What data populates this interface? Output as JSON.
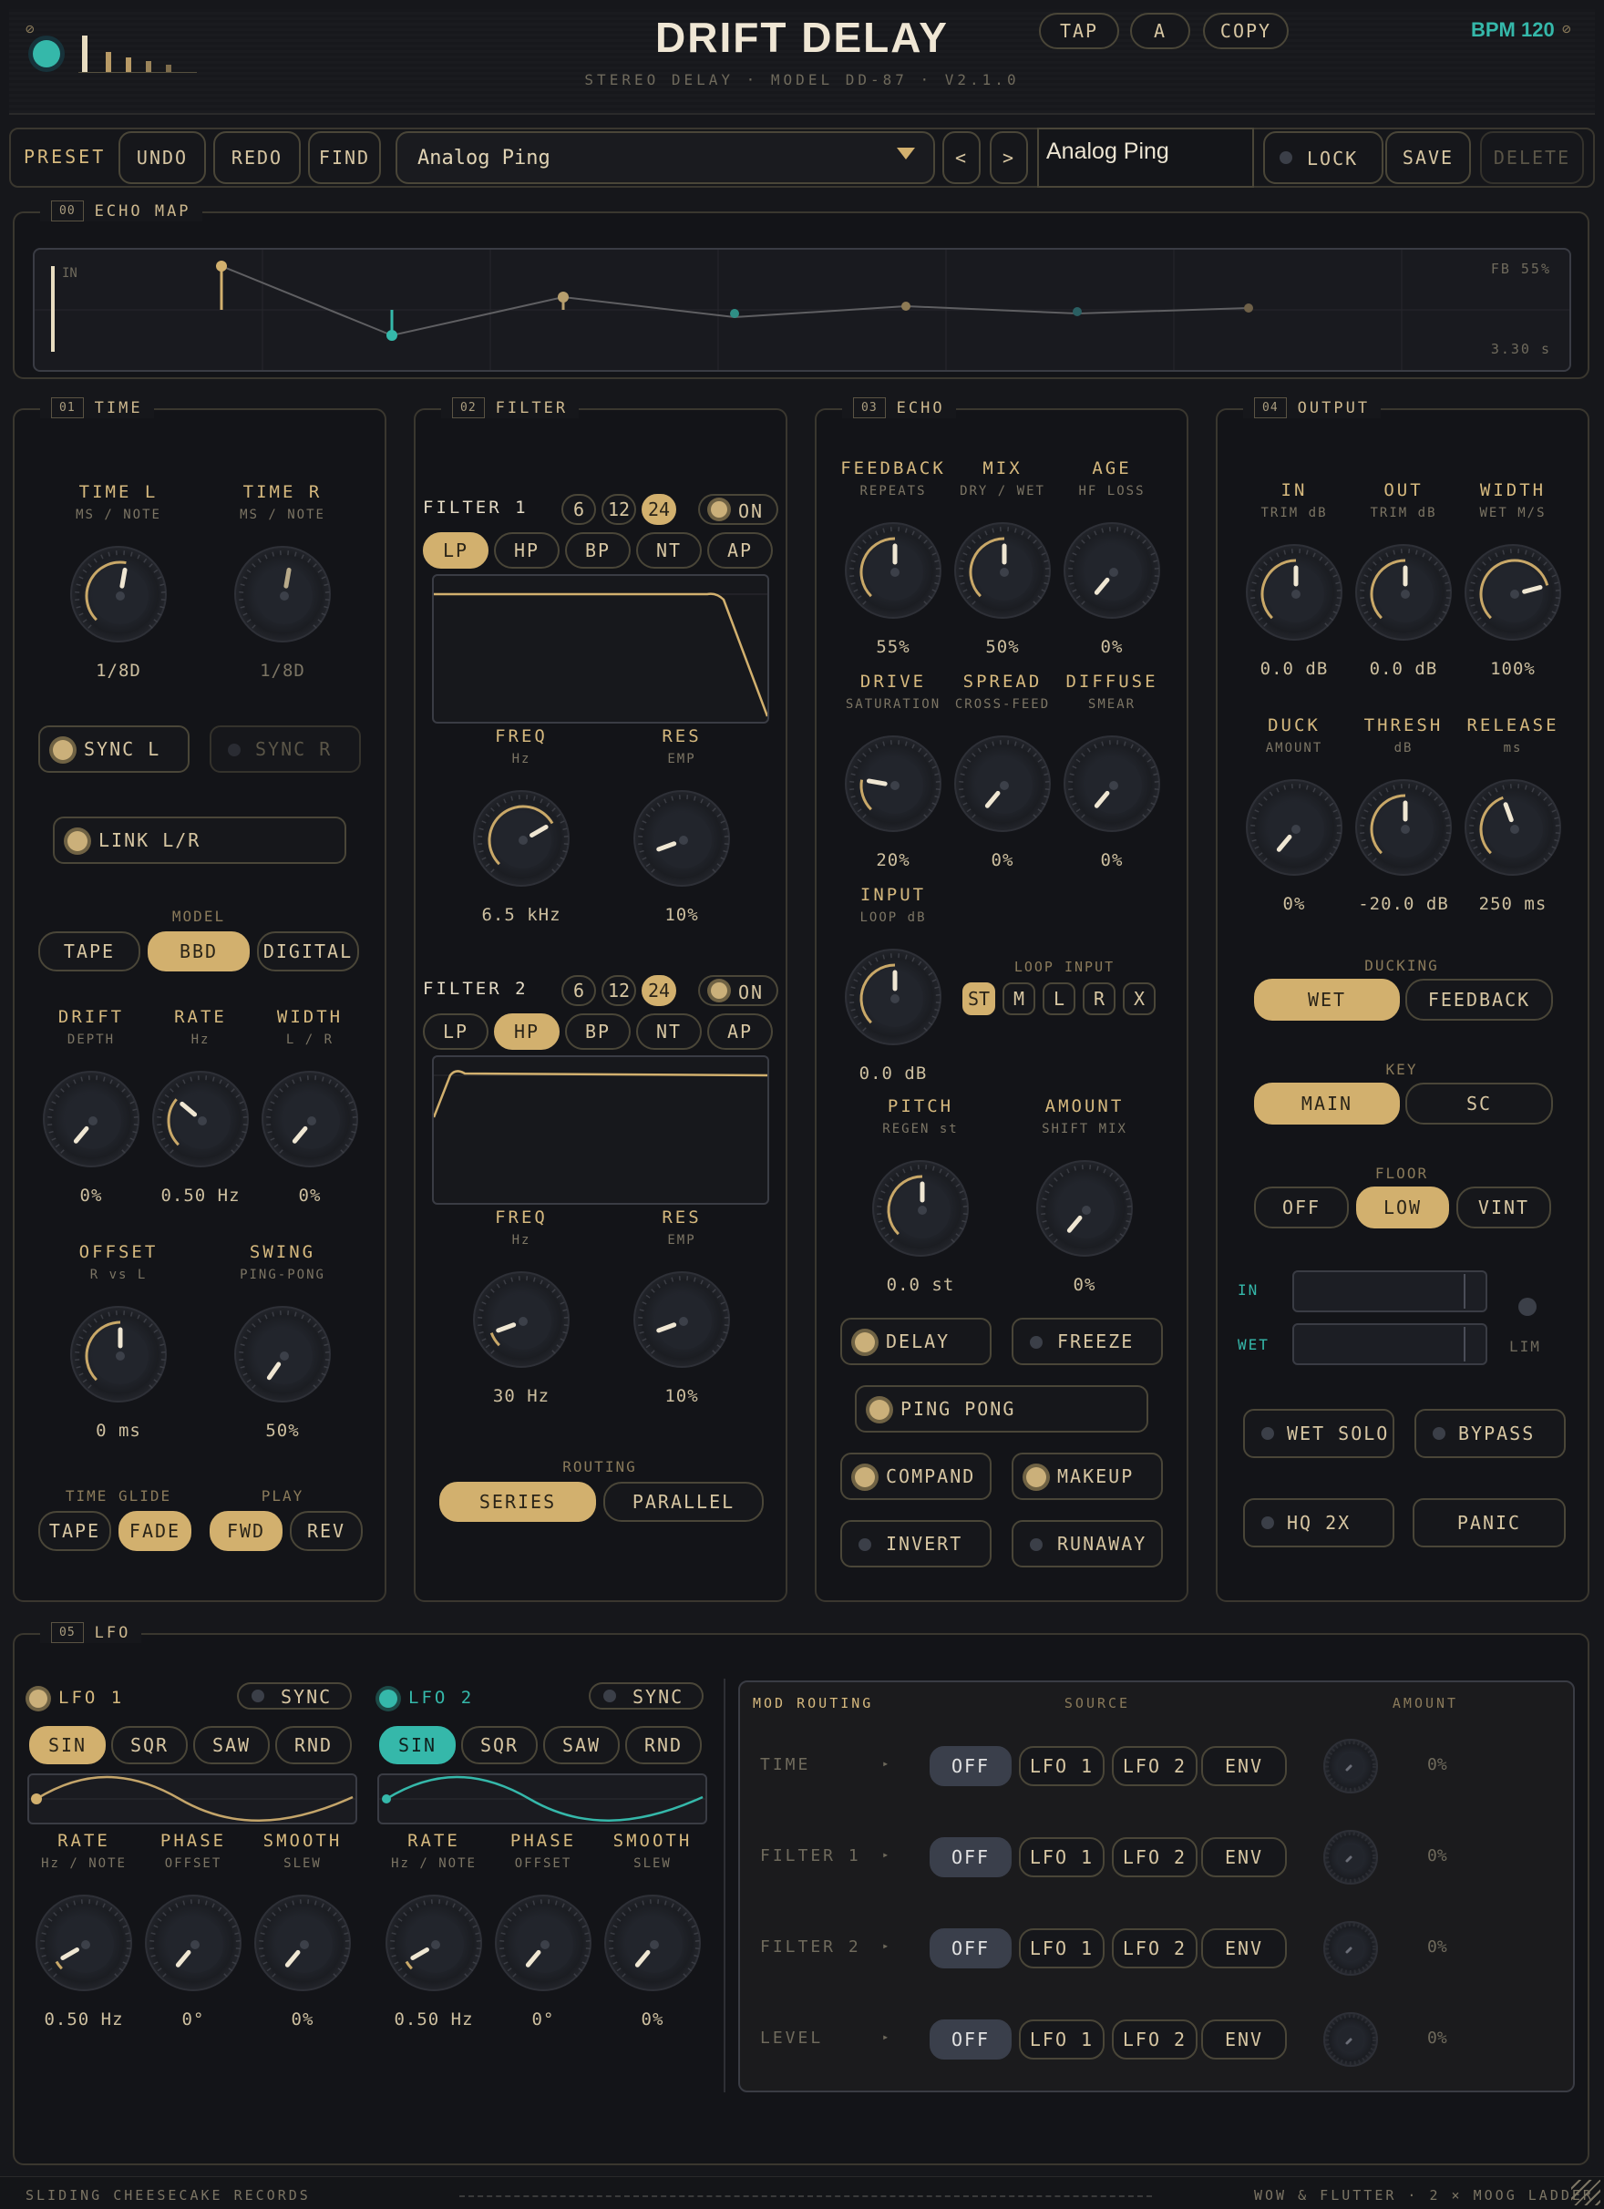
{
  "header": {
    "title": "DRIFT DELAY",
    "subtitle": "STEREO DELAY · MODEL DD-87 · V2.1.0",
    "tap": "TAP",
    "a": "A",
    "copy": "COPY",
    "bpm": "BPM 120"
  },
  "preset": {
    "label": "PRESET",
    "undo": "UNDO",
    "redo": "REDO",
    "find": "FIND",
    "selected": "Analog Ping",
    "prev": "<",
    "next": ">",
    "name_value": "Analog Ping",
    "lock": "LOCK",
    "save": "SAVE",
    "delete": "DELETE"
  },
  "echo_map": {
    "num": "00",
    "title": "ECHO MAP",
    "in": "IN",
    "fb": "FB 55%",
    "time": "3.30 s"
  },
  "time": {
    "num": "01",
    "title": "TIME",
    "time_l": {
      "label": "TIME L",
      "sub": "MS / NOTE",
      "value": "1/8D"
    },
    "time_r": {
      "label": "TIME R",
      "sub": "MS / NOTE",
      "value": "1/8D"
    },
    "sync_l": "SYNC L",
    "sync_r": "SYNC R",
    "link": "LINK L/R",
    "model_label": "MODEL",
    "models": [
      "TAPE",
      "BBD",
      "DIGITAL"
    ],
    "drift": {
      "label": "DRIFT",
      "sub": "DEPTH",
      "value": "0%"
    },
    "rate": {
      "label": "RATE",
      "sub": "Hz",
      "value": "0.50 Hz"
    },
    "width": {
      "label": "WIDTH",
      "sub": "L / R",
      "value": "0%"
    },
    "offset": {
      "label": "OFFSET",
      "sub": "R vs L",
      "value": "0 ms"
    },
    "swing": {
      "label": "SWING",
      "sub": "PING-PONG",
      "value": "50%"
    },
    "glide_label": "TIME GLIDE",
    "glide": [
      "TAPE",
      "FADE"
    ],
    "play_label": "PLAY",
    "play": [
      "FWD",
      "REV"
    ]
  },
  "filter": {
    "num": "02",
    "title": "FILTER",
    "f1": {
      "title": "FILTER 1",
      "slopes": [
        "6",
        "12",
        "24"
      ],
      "on": "ON",
      "types": [
        "LP",
        "HP",
        "BP",
        "NT",
        "AP"
      ],
      "freq": {
        "label": "FREQ",
        "sub": "Hz",
        "value": "6.5 kHz"
      },
      "res": {
        "label": "RES",
        "sub": "EMP",
        "value": "10%"
      }
    },
    "f2": {
      "title": "FILTER 2",
      "slopes": [
        "6",
        "12",
        "24"
      ],
      "on": "ON",
      "types": [
        "LP",
        "HP",
        "BP",
        "NT",
        "AP"
      ],
      "freq": {
        "label": "FREQ",
        "sub": "Hz",
        "value": "30 Hz"
      },
      "res": {
        "label": "RES",
        "sub": "EMP",
        "value": "10%"
      }
    },
    "routing_label": "ROUTING",
    "series": "SERIES",
    "parallel": "PARALLEL"
  },
  "echo": {
    "num": "03",
    "title": "ECHO",
    "feedback": {
      "label": "FEEDBACK",
      "sub": "REPEATS",
      "value": "55%"
    },
    "mix": {
      "label": "MIX",
      "sub": "DRY / WET",
      "value": "50%"
    },
    "age": {
      "label": "AGE",
      "sub": "HF LOSS",
      "value": "0%"
    },
    "drive": {
      "label": "DRIVE",
      "sub": "SATURATION",
      "value": "20%"
    },
    "spread": {
      "label": "SPREAD",
      "sub": "CROSS-FEED",
      "value": "0%"
    },
    "diffuse": {
      "label": "DIFFUSE",
      "sub": "SMEAR",
      "value": "0%"
    },
    "input": {
      "label": "INPUT",
      "sub": "LOOP dB",
      "value": "0.0 dB"
    },
    "loop_label": "LOOP INPUT",
    "loop": [
      "ST",
      "M",
      "L",
      "R",
      "X"
    ],
    "pitch": {
      "label": "PITCH",
      "sub": "REGEN st",
      "value": "0.0 st"
    },
    "amount": {
      "label": "AMOUNT",
      "sub": "SHIFT MIX",
      "value": "0%"
    },
    "delay": "DELAY",
    "freeze": "FREEZE",
    "pingpong": "PING PONG",
    "compand": "COMPAND",
    "makeup": "MAKEUP",
    "invert": "INVERT",
    "runaway": "RUNAWAY"
  },
  "output": {
    "num": "04",
    "title": "OUTPUT",
    "in": {
      "label": "IN",
      "sub": "TRIM dB",
      "value": "0.0 dB"
    },
    "out": {
      "label": "OUT",
      "sub": "TRIM dB",
      "value": "0.0 dB"
    },
    "width": {
      "label": "WIDTH",
      "sub": "WET M/S",
      "value": "100%"
    },
    "duck": {
      "label": "DUCK",
      "sub": "AMOUNT",
      "value": "0%"
    },
    "thresh": {
      "label": "THRESH",
      "sub": "dB",
      "value": "-20.0 dB"
    },
    "release": {
      "label": "RELEASE",
      "sub": "ms",
      "value": "250 ms"
    },
    "ducking_label": "DUCKING",
    "wet": "WET",
    "feedback": "FEEDBACK",
    "key_label": "KEY",
    "main": "MAIN",
    "sc": "SC",
    "floor_label": "FLOOR",
    "floor": [
      "OFF",
      "LOW",
      "VINT"
    ],
    "meter_in": "IN",
    "meter_wet": "WET",
    "lim": "LIM",
    "wet_solo": "WET SOLO",
    "bypass": "BYPASS",
    "hq": "HQ 2X",
    "panic": "PANIC"
  },
  "lfo": {
    "num": "05",
    "title": "LFO",
    "lfo1": {
      "title": "LFO 1",
      "sync": "SYNC",
      "shapes": [
        "SIN",
        "SQR",
        "SAW",
        "RND"
      ],
      "rate": {
        "label": "RATE",
        "sub": "Hz / NOTE",
        "value": "0.50 Hz"
      },
      "phase": {
        "label": "PHASE",
        "sub": "OFFSET",
        "value": "0°"
      },
      "smooth": {
        "label": "SMOOTH",
        "sub": "SLEW",
        "value": "0%"
      }
    },
    "lfo2": {
      "title": "LFO 2",
      "sync": "SYNC",
      "shapes": [
        "SIN",
        "SQR",
        "SAW",
        "RND"
      ],
      "rate": {
        "label": "RATE",
        "sub": "Hz / NOTE",
        "value": "0.50 Hz"
      },
      "phase": {
        "label": "PHASE",
        "sub": "OFFSET",
        "value": "0°"
      },
      "smooth": {
        "label": "SMOOTH",
        "sub": "SLEW",
        "value": "0%"
      }
    },
    "routing": {
      "title": "MOD ROUTING",
      "source": "SOURCE",
      "amount": "AMOUNT",
      "sources": [
        "OFF",
        "LFO 1",
        "LFO 2",
        "ENV"
      ],
      "rows": [
        {
          "target": "TIME",
          "arrow": "▸",
          "amount": "0%"
        },
        {
          "target": "FILTER 1",
          "arrow": "▸",
          "amount": "0%"
        },
        {
          "target": "FILTER 2",
          "arrow": "▸",
          "amount": "0%"
        },
        {
          "target": "LEVEL",
          "arrow": "▸",
          "amount": "0%"
        }
      ]
    }
  },
  "footer": {
    "left": "SLIDING CHEESECAKE RECORDS",
    "right": "WOW & FLUTTER · 2 × MOOG LADDER"
  },
  "colors": {
    "accent": "#d2b06e",
    "teal": "#35b8aa",
    "background": "#16171b"
  }
}
